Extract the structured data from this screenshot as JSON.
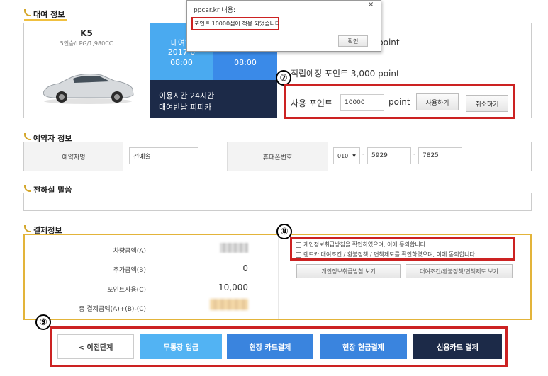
{
  "sections": {
    "rental": "대여 정보",
    "booker": "예약자 정보",
    "message": "전하실 말씀",
    "payment": "결제정보"
  },
  "car": {
    "name": "K5",
    "spec": "5인승/LPG/1,980CC"
  },
  "rental_times": {
    "start_label": "대여일",
    "start_date": "2017.0",
    "start_time": "08:00",
    "end_time": "08:00",
    "duration": "이용시간 24시간",
    "place": "대여반납 피피카"
  },
  "points": {
    "available_suffix": "point",
    "expected": "적립예정 포인트 3,000 point",
    "use_label": "사용 포인트",
    "use_value": "10000",
    "unit": "point",
    "apply_button": "사용하기",
    "cancel_button": "취소하기"
  },
  "booker": {
    "name_label": "예약자명",
    "name_value": "전예솔",
    "phone_label": "휴대폰번호",
    "phone_prefix": "010",
    "phone_mid": "5929",
    "phone_last": "7825",
    "dash": "-"
  },
  "payment": {
    "rows": [
      {
        "label": "차량금액(A)",
        "value": ""
      },
      {
        "label": "추가금액(B)",
        "value": "0"
      },
      {
        "label": "포인트사용(C)",
        "value": "10,000"
      },
      {
        "label": "총 결제금액(A)+(B)-(C)",
        "value": ""
      }
    ],
    "agree_privacy": "개인정보취급방침을 확인하였으며, 이에 동의합니다.",
    "agree_terms": "렌트카 대여조건 / 환불정책 / 면책제도를 확인하였으며, 이에 동의합니다.",
    "view_privacy": "개인정보취급방침 보기",
    "view_terms": "대여조건/환불정책/면책제도 보기"
  },
  "actions": {
    "prev": "< 이전단계",
    "bank": "무통장 입금",
    "onsite_card": "현장 카드결제",
    "onsite_cash": "현장 현금결제",
    "credit_card": "신용카드 결제"
  },
  "markers": {
    "seven": "⑦",
    "eight": "⑧",
    "nine": "⑨"
  },
  "dialog": {
    "title": "ppcar.kr 내용:",
    "message": "포인트 10000점이 적용 되었습니다",
    "ok": "확인",
    "close": "×"
  },
  "colors": {
    "light_blue": "#4aaaf0",
    "mid_blue": "#3a8ae8",
    "dark_navy": "#1c2a48",
    "highlight_red": "#cc2222",
    "section_yellow": "#e3b43a"
  }
}
